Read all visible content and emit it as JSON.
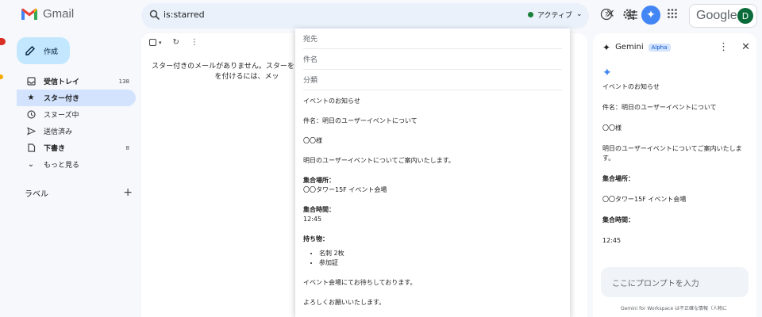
{
  "app": {
    "name": "Gmail",
    "brand_word": "Google",
    "avatar_letter": "D"
  },
  "search": {
    "query": "is:starred",
    "status": "アクティブ"
  },
  "sidebar": {
    "compose": "作成",
    "items": [
      {
        "label": "受信トレイ",
        "count": "138",
        "icon": "inbox-icon"
      },
      {
        "label": "スター付き",
        "count": "",
        "icon": "star-icon"
      },
      {
        "label": "スヌーズ中",
        "count": "",
        "icon": "clock-icon"
      },
      {
        "label": "送信済み",
        "count": "",
        "icon": "send-icon"
      },
      {
        "label": "下書き",
        "count": "8",
        "icon": "draft-icon"
      },
      {
        "label": "もっと見る",
        "count": "",
        "icon": "chevron-down-icon"
      }
    ],
    "labels_heading": "ラベル"
  },
  "main": {
    "empty_line1": "スター付きのメールがありません。スターを",
    "empty_line2": "を付けるには、メッ"
  },
  "draft": {
    "to": "宛先",
    "subject": "件名",
    "category": "分類",
    "body": {
      "p1": "イベントのお知らせ",
      "p2": "件名：明日のユーザーイベントについて",
      "p3": "〇〇様",
      "p4": "明日のユーザーイベントについてご案内いたします。",
      "place_h": "集合場所：",
      "place_v": "〇〇タワー15F イベント会場",
      "time_h": "集合時間：",
      "time_v": "12:45",
      "items_h": "持ち物：",
      "item1": "名刺 2枚",
      "item2": "参加証",
      "p5": "イベント会場にてお待ちしております。",
      "p6": "よろしくお願いいたします。"
    }
  },
  "gemini": {
    "title": "Gemini",
    "badge": "Alpha",
    "l1": "イベントのお知らせ",
    "l2": "件名：明日のユーザーイベントについて",
    "l3": "〇〇様",
    "l4": "明日のユーザーイベントについてご案内いたします。",
    "l5": "集合場所：",
    "l6": "〇〇タワー15F イベント会場",
    "l7": "集合時間：",
    "l8": "12:45",
    "prompt_placeholder": "ここにプロンプトを入力",
    "disclaimer": "Gemini for Workspace は不正確な情報（人物に"
  },
  "colors": {
    "accent": "#0b57d0",
    "compose_bg": "#c2e7ff",
    "active_nav": "#d3e3fd",
    "gemini_blue": "#4285f4",
    "page_bg": "#f6f8fc"
  }
}
